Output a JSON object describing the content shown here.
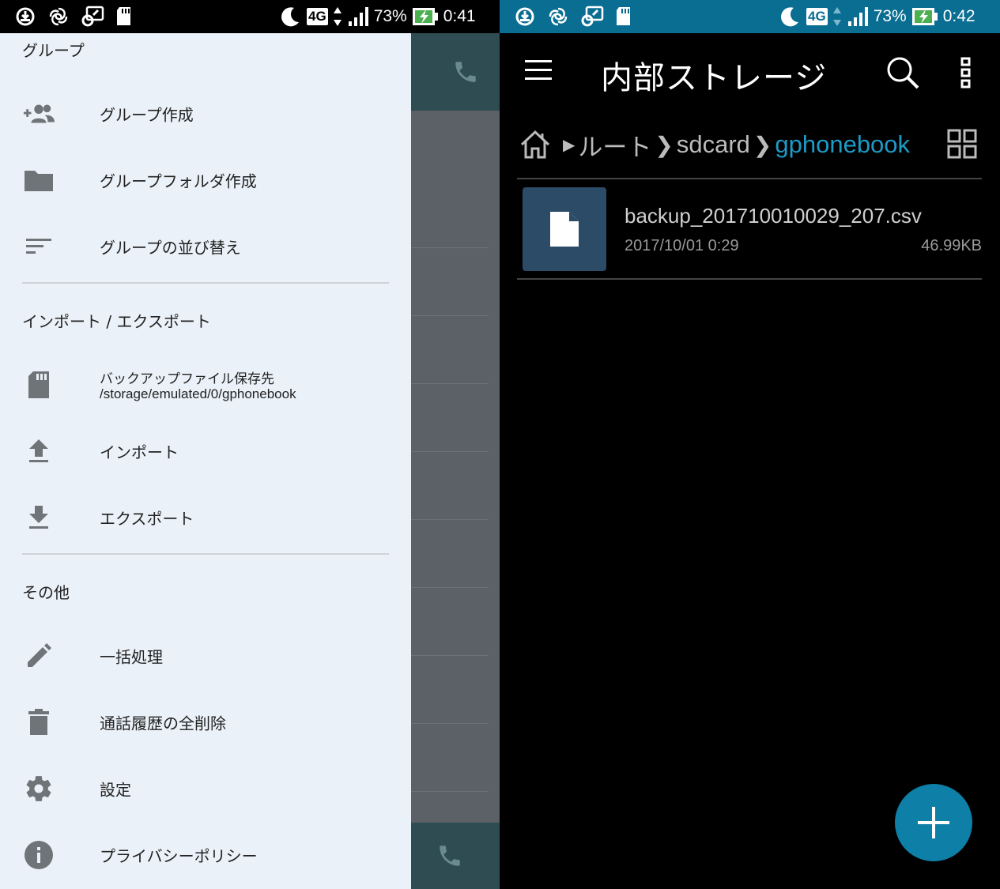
{
  "left_phone": {
    "status_bar": {
      "network": "4G",
      "battery": "73%",
      "time": "0:41"
    },
    "drawer": {
      "sections": [
        {
          "header": "グループ",
          "items": [
            {
              "label": "グループ作成",
              "icon": "group-add-icon"
            },
            {
              "label": "グループフォルダ作成",
              "icon": "folder-icon"
            },
            {
              "label": "グループの並び替え",
              "icon": "sort-icon"
            }
          ]
        },
        {
          "header": "インポート / エクスポート",
          "items": [
            {
              "label": "バックアップファイル保存先",
              "sublabel": "/storage/emulated/0/gphonebook",
              "icon": "sd-card-icon"
            },
            {
              "label": "インポート",
              "icon": "upload-icon"
            },
            {
              "label": "エクスポート",
              "icon": "download-icon"
            }
          ]
        },
        {
          "header": "その他",
          "items": [
            {
              "label": "一括処理",
              "icon": "edit-icon"
            },
            {
              "label": "通話履歴の全削除",
              "icon": "trash-icon"
            },
            {
              "label": "設定",
              "icon": "gear-icon"
            },
            {
              "label": "プライバシーポリシー",
              "icon": "info-icon"
            }
          ]
        }
      ]
    }
  },
  "right_phone": {
    "status_bar": {
      "network": "4G",
      "battery": "73%",
      "time": "0:42"
    },
    "app_bar": {
      "title": "内部ストレージ"
    },
    "breadcrumb": [
      "ルート",
      "sdcard",
      "gphonebook"
    ],
    "files": [
      {
        "name": "backup_201710010029_207.csv",
        "date": "2017/10/01 0:29",
        "size": "46.99KB"
      }
    ]
  },
  "colors": {
    "drawer_bg": "#ebf1f8",
    "scrim": "#5b6166",
    "left_toolbar": "#2f4c52",
    "right_statusbar": "#0a6d92",
    "accent": "#1e9ac7",
    "fab": "#0e7fa6",
    "file_thumb": "#2c4b66"
  }
}
